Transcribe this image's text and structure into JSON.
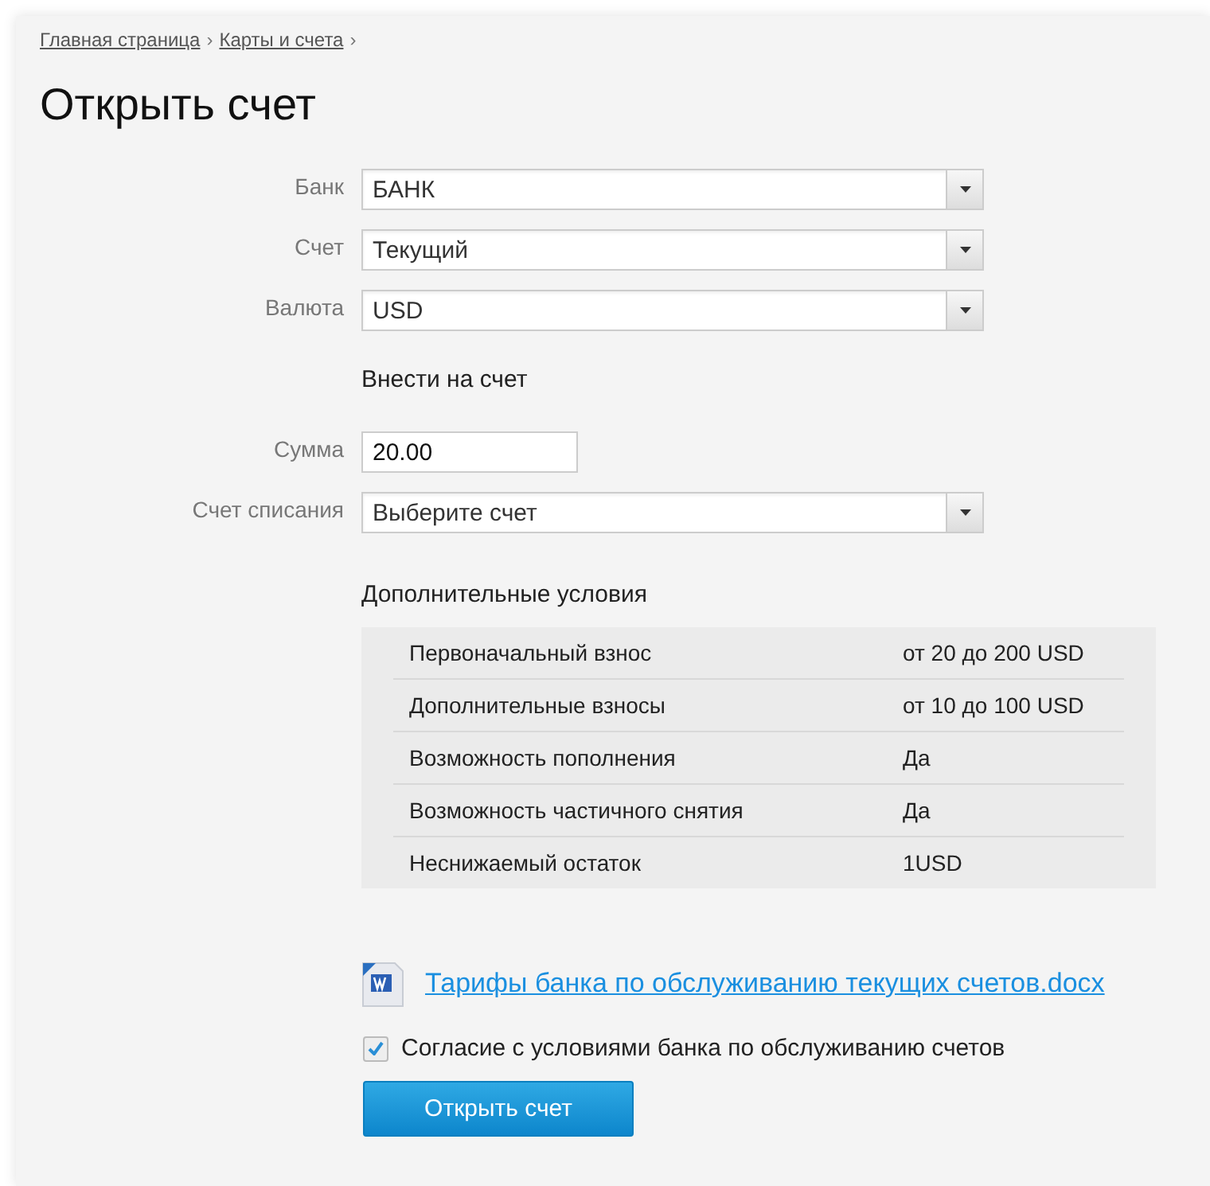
{
  "breadcrumbs": [
    {
      "label": "Главная страница",
      "separator": "›"
    },
    {
      "label": "Карты и счета",
      "separator": "›"
    }
  ],
  "title": "Открыть счет",
  "fields": [
    {
      "label": "Банк",
      "kind": "select",
      "value": "БАНК"
    },
    {
      "label": "Счет",
      "kind": "select",
      "value": "Текущий"
    },
    {
      "label": "Валюта",
      "kind": "select",
      "value": "USD"
    }
  ],
  "deposit": {
    "title": "Внести на счет",
    "fields": [
      {
        "label": "Сумма",
        "kind": "input",
        "value": "20.00"
      },
      {
        "label": "Счет списания",
        "kind": "select",
        "value": "Выберите счет"
      }
    ]
  },
  "conditions": {
    "title": "Дополнительные условия",
    "rows": [
      {
        "name": "Первоначальный взнос",
        "value": "от 20 до 200 USD"
      },
      {
        "name": "Дополнительные взносы",
        "value": "от 10 до 100 USD"
      },
      {
        "name": "Возможность пополнения",
        "value": "Да"
      },
      {
        "name": "Возможность частичного снятия",
        "value": "Да"
      },
      {
        "name": "Неснижаемый остаток",
        "value": "1USD"
      }
    ]
  },
  "document_link": "Тарифы банка по обслуживанию текущих счетов.docx",
  "agreement": {
    "label": "Согласие с условиями банка по обслуживанию счетов",
    "checked": true
  },
  "submit_button": "Открыть счет"
}
